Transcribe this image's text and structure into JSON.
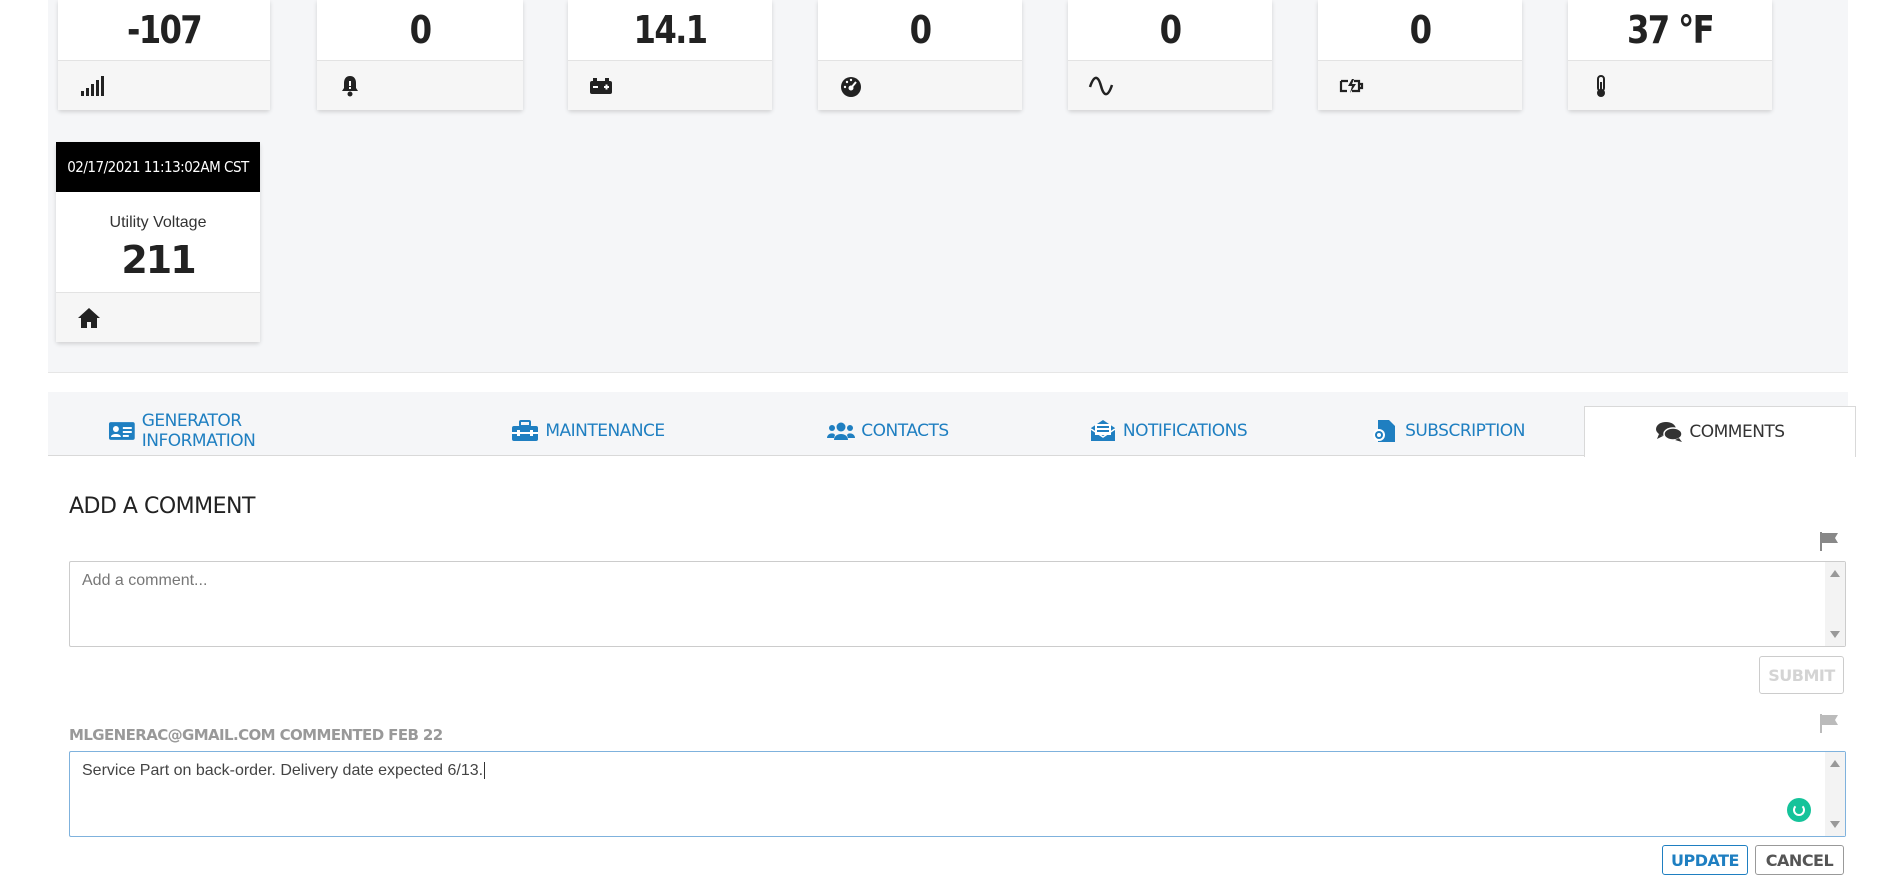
{
  "stat_cards": [
    {
      "value": "-107",
      "icon": "signal-icon"
    },
    {
      "value": "0",
      "icon": "bell-alert-icon"
    },
    {
      "value": "14.1",
      "icon": "battery-icon"
    },
    {
      "value": "0",
      "icon": "speedometer-icon"
    },
    {
      "value": "0",
      "icon": "sine-wave-icon"
    },
    {
      "value": "0",
      "icon": "charging-icon"
    },
    {
      "value": "37 °F",
      "icon": "thermometer-icon"
    }
  ],
  "timestamp_card": {
    "timestamp": "02/17/2021 11:13:02AM CST",
    "label": "Utility Voltage",
    "value": "211",
    "icon": "home-icon"
  },
  "tabs": [
    {
      "label": "GENERATOR INFORMATION",
      "icon": "id-card-icon",
      "active": false
    },
    {
      "label": "MAINTENANCE",
      "icon": "toolbox-icon",
      "active": false
    },
    {
      "label": "CONTACTS",
      "icon": "users-icon",
      "active": false
    },
    {
      "label": "NOTIFICATIONS",
      "icon": "envelope-open-icon",
      "active": false
    },
    {
      "label": "SUBSCRIPTION",
      "icon": "file-contract-icon",
      "active": false
    },
    {
      "label": "COMMENTS",
      "icon": "comments-icon",
      "active": true
    }
  ],
  "comments_section": {
    "title": "ADD A COMMENT",
    "new_comment_placeholder": "Add a comment...",
    "submit_label": "SUBMIT",
    "existing": {
      "header": "MLGENERAC@GMAIL.COM COMMENTED FEB 22",
      "text": "Service Part on back-order.  Delivery date expected 6/13.",
      "update_label": "UPDATE",
      "cancel_label": "CANCEL"
    }
  },
  "colors": {
    "accent": "#1f7fc1",
    "background": "#f5f6f8",
    "grammarly": "#15c39a"
  }
}
